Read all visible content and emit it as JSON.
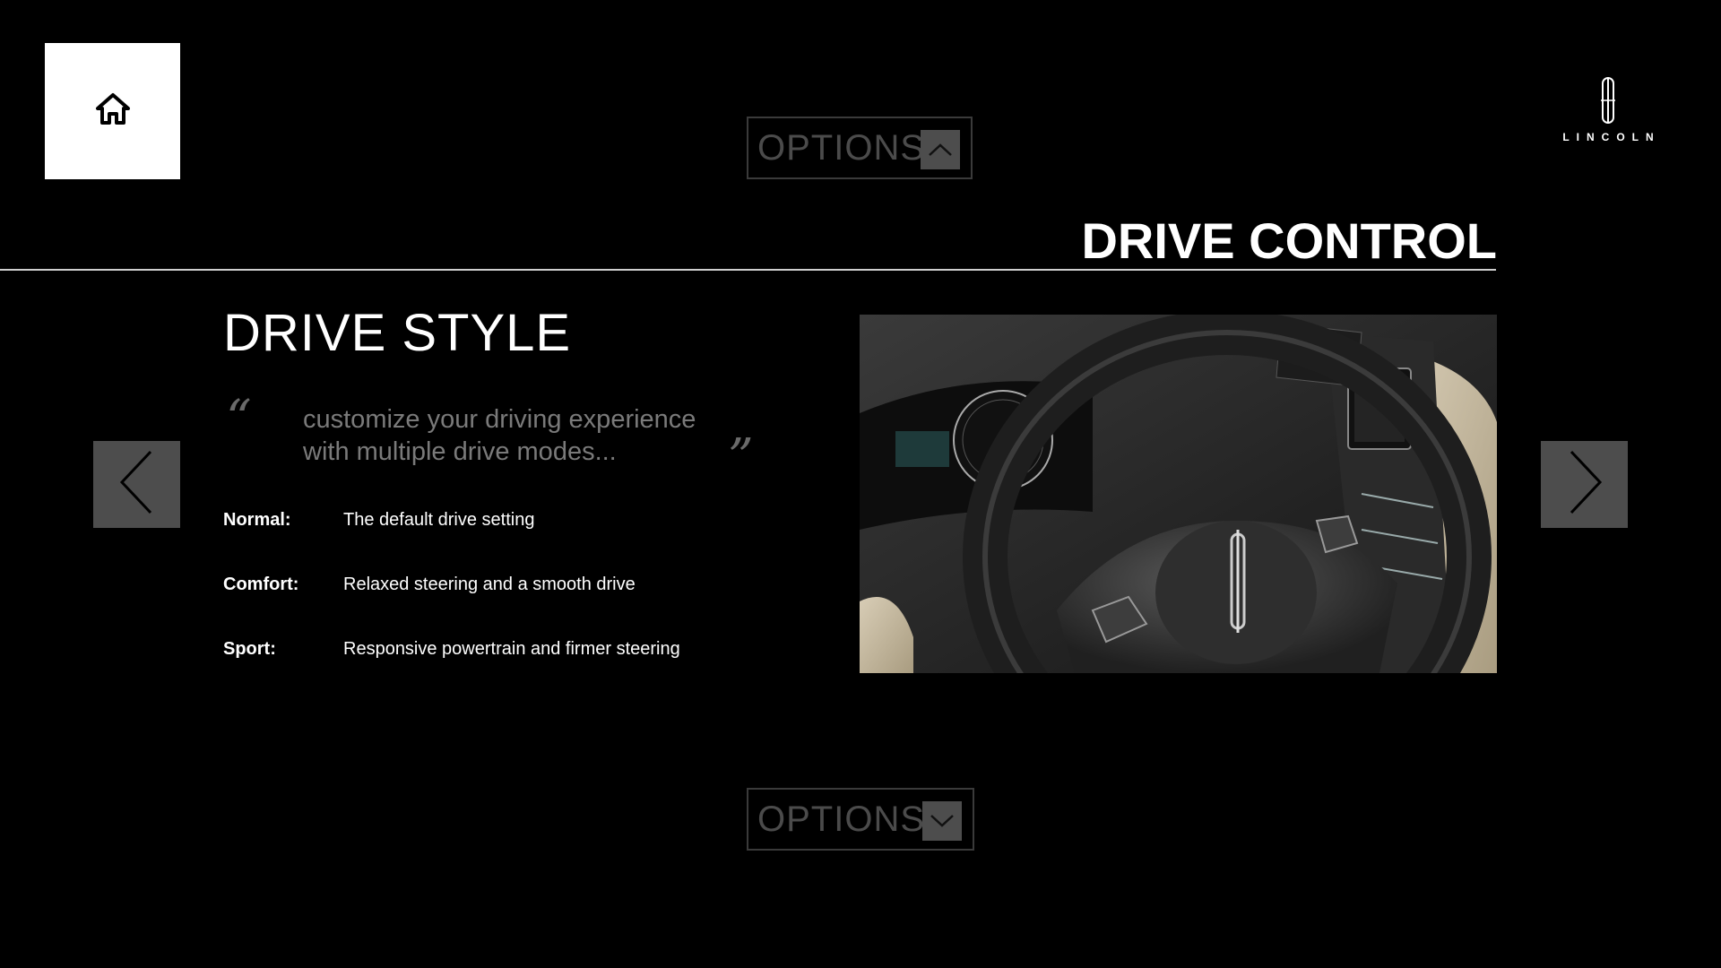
{
  "header": {
    "home_icon": "home-icon",
    "options_top_label": "OPTIONS",
    "options_top_icon": "chevron-up-icon",
    "logo_text": "LINCOLN"
  },
  "section": {
    "title": "DRIVE CONTROL"
  },
  "content": {
    "heading": "DRIVE STYLE",
    "quote_open": "“",
    "quote_close": "”",
    "quote_line1": "customize your driving experience",
    "quote_line2": "with multiple drive modes...",
    "modes": [
      {
        "name": "Normal:",
        "desc": "The default drive setting"
      },
      {
        "name": "Comfort:",
        "desc": "Relaxed steering and a smooth drive"
      },
      {
        "name": "Sport:",
        "desc": "Responsive powertrain and firmer steering"
      }
    ]
  },
  "navigation": {
    "prev_icon": "chevron-left-icon",
    "next_icon": "chevron-right-icon"
  },
  "footer": {
    "options_bottom_label": "OPTIONS",
    "options_bottom_icon": "chevron-down-icon"
  },
  "colors": {
    "background": "#000000",
    "button_gray": "#4d4d4d",
    "muted_text": "#7a7a7a",
    "options_text": "#4b4b4b"
  }
}
